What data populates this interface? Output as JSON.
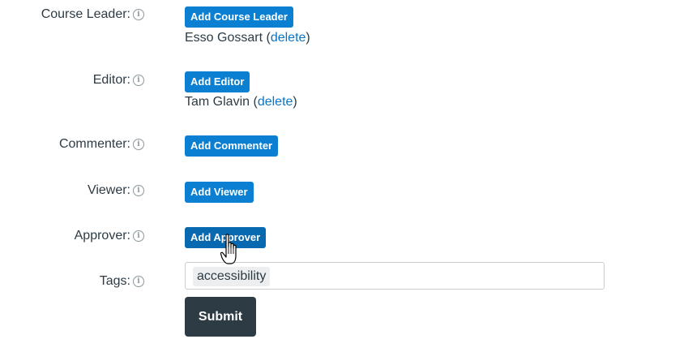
{
  "roles": [
    {
      "label": "Course Leader:",
      "button": "Add Course Leader",
      "member": "Esso Gossart",
      "member_action": "delete"
    },
    {
      "label": "Editor:",
      "button": "Add Editor",
      "member": "Tam Glavin",
      "member_action": "delete"
    },
    {
      "label": "Commenter:",
      "button": "Add Commenter"
    },
    {
      "label": "Viewer:",
      "button": "Add Viewer"
    },
    {
      "label": "Approver:",
      "button": "Add Approver"
    }
  ],
  "tags": {
    "label": "Tags:",
    "values": [
      "accessibility"
    ]
  },
  "submit_label": "Submit",
  "info_glyph": "i",
  "colors": {
    "button": "#0b7fd1",
    "link": "#0b74c2",
    "submit": "#2d3b45",
    "text": "#2d3b45"
  }
}
